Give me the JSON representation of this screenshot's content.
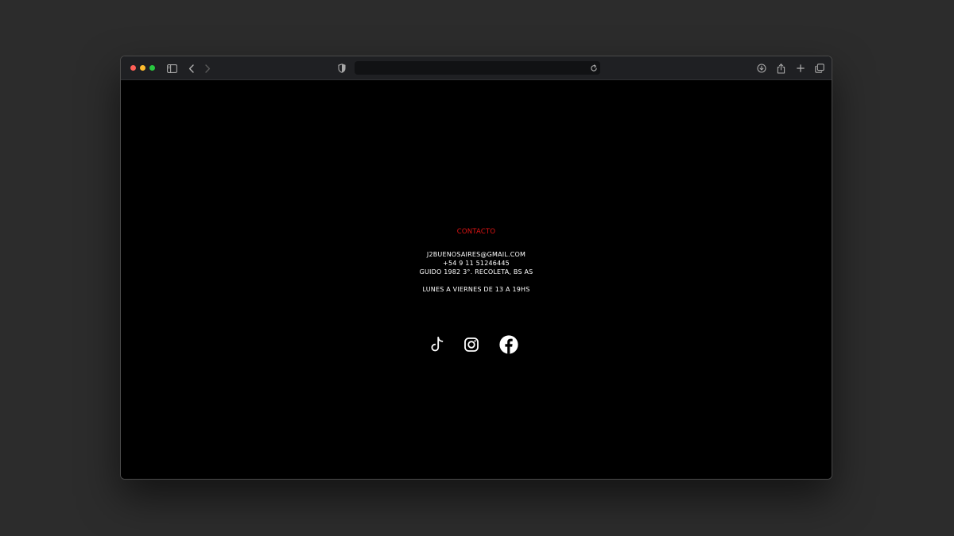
{
  "browser": {
    "url": "",
    "traffic_lights": {
      "close": "#ff5f57",
      "minimize": "#febc2e",
      "maximize": "#28c840"
    },
    "icons": [
      "sidebar-icon",
      "back-icon",
      "forward-icon",
      "shield-icon",
      "reload-icon",
      "download-icon",
      "share-icon",
      "new-tab-icon",
      "tabs-overview-icon"
    ]
  },
  "page": {
    "contact": {
      "title": "CONTACTO",
      "email": "J2BUENOSAIRES@GMAIL.COM",
      "phone": "+54 9 11 51246445",
      "address": "GUIDO 1982 3°. RECOLETA, BS AS",
      "hours": "LUNES A VIERNES DE 13 A 19HS"
    },
    "social": [
      "tiktok-icon",
      "instagram-icon",
      "facebook-icon"
    ],
    "colors": {
      "accent": "#e01414",
      "text": "#ffffff",
      "background": "#000000"
    }
  }
}
